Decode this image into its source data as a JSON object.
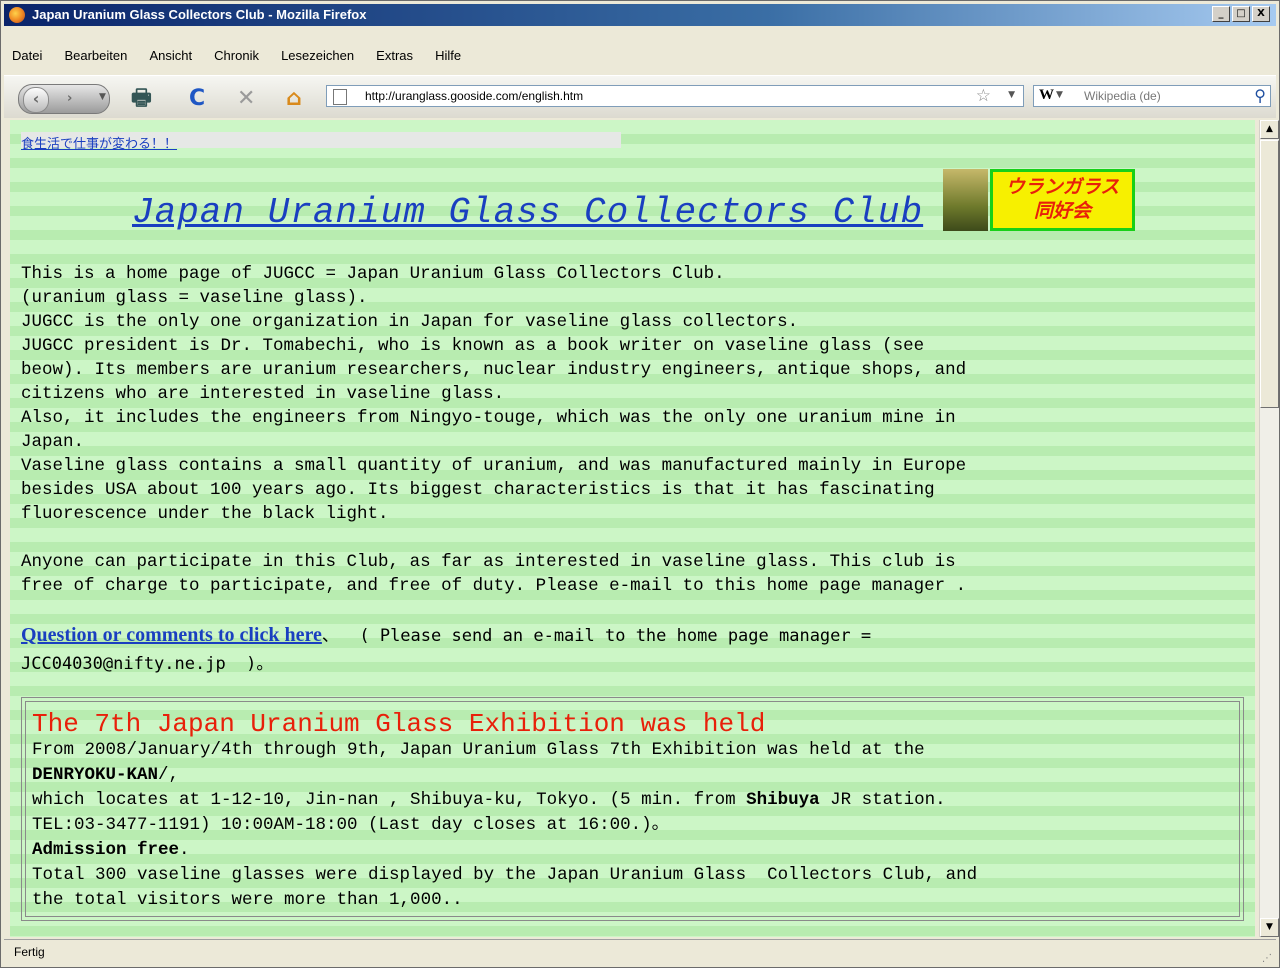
{
  "window": {
    "title": "Japan Uranium Glass Collectors Club - Mozilla Firefox",
    "min_label": "_",
    "max_label": "□",
    "close_label": "X"
  },
  "menu": [
    "Datei",
    "Bearbeiten",
    "Ansicht",
    "Chronik",
    "Lesezeichen",
    "Extras",
    "Hilfe"
  ],
  "toolbar": {
    "url": "http://uranglass.gooside.com/english.htm",
    "search_placeholder": "Wikipedia (de)",
    "search_engine_letter": "W"
  },
  "page": {
    "top_link": "食生活で仕事が変わる！！",
    "title": "Japan Uranium Glass Collectors Club",
    "logo_text_line1": "ウランガラス",
    "logo_text_line2": "同好会",
    "intro": "This is a home page of JUGCC = Japan Uranium Glass Collectors Club.\n(uranium glass = vaseline glass).\nJUGCC is the only one organization in Japan for vaseline glass collectors.\nJUGCC president is Dr. Tomabechi, who is known as a book writer on vaseline glass (see\nbeow). Its members are uranium researchers, nuclear industry engineers, antique shops, and\ncitizens who are interested in vaseline glass.\nAlso, it includes the engineers from Ningyo-touge, which was the only one uranium mine in\nJapan.\nVaseline glass contains a small quantity of uranium, and was manufactured mainly in Europe\nbesides USA about 100 years ago. Its biggest characteristics is that it has fascinating\nfluorescence under the black light.\n\nAnyone can participate in this Club, as far as interested in vaseline glass. This club is\nfree of charge to participate, and free of duty. Please e-mail to this home page manager .",
    "question_link": "Question or comments to click here",
    "question_rest": "、  ( Please send an e-mail to the home page manager =\nJCC04030@nifty.ne.jp  )。",
    "exhibit": {
      "heading": "The 7th Japan Uranium Glass Exhibition was held",
      "line1": "From 2008/January/4th through 9th, Japan Uranium Glass 7th Exhibition was held at the",
      "venue_bold": "DENRYOKU-KAN",
      "venue_tail": "/,",
      "line2_pre": "which locates at 1-12-10, Jin-nan , Shibuya-ku, Tokyo. (5 min. from ",
      "line2_bold": "Shibuya",
      "line2_post": " JR station.",
      "line3": "TEL:03-3477-1191) 10:00AM-18:00 (Last day closes at 16:00.)。",
      "admission_bold": "Admission free",
      "admission_tail": ".",
      "line4": "Total 300 vaseline glasses were displayed by the Japan Uranium Glass  Collectors Club, and\nthe total visitors were more than 1,000.."
    }
  },
  "status": "Fertig"
}
